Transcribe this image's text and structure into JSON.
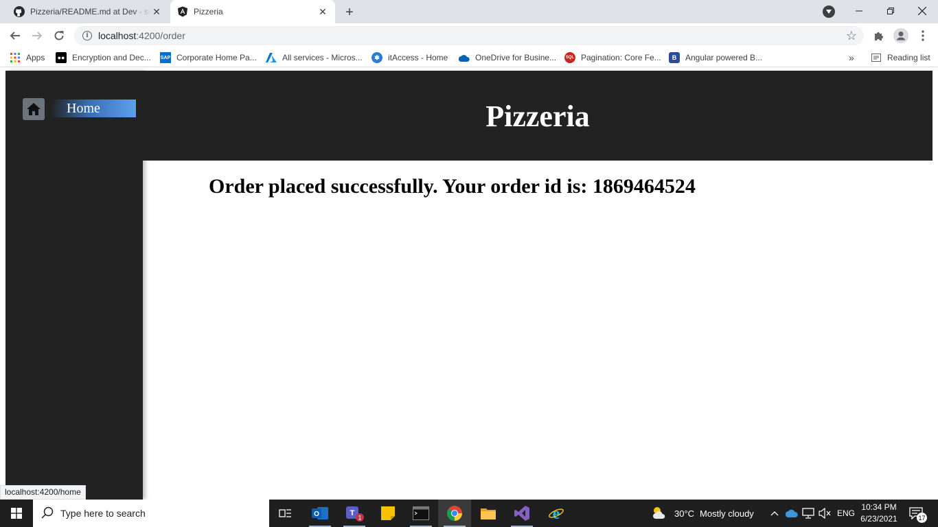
{
  "browser": {
    "tabs": [
      {
        "title": "Pizzeria/README.md at Dev · sud",
        "favicon": "github-icon",
        "active": false
      },
      {
        "title": "Pizzeria",
        "favicon": "angular-icon",
        "active": true
      }
    ],
    "address": {
      "host": "localhost",
      "path": ":4200/order"
    },
    "bookmarks": [
      {
        "label": "Apps",
        "icon": "apps-grid-icon"
      },
      {
        "label": "Encryption and Dec...",
        "icon": "medium-icon"
      },
      {
        "label": "Corporate Home Pa...",
        "icon": "sap-icon"
      },
      {
        "label": "All services - Micros...",
        "icon": "azure-icon"
      },
      {
        "label": "itAccess - Home",
        "icon": "itaccess-icon"
      },
      {
        "label": "OneDrive for Busine...",
        "icon": "onedrive-icon"
      },
      {
        "label": "Pagination: Core Fe...",
        "icon": "sql-icon"
      },
      {
        "label": "Angular powered B...",
        "icon": "bootstrap-icon"
      }
    ],
    "reading_list": "Reading list",
    "status_bar": "localhost:4200/home"
  },
  "app": {
    "title": "Pizzeria",
    "nav": {
      "home_label": "Home"
    },
    "order_message": "Order placed successfully. Your order id is: 1869464524"
  },
  "taskbar": {
    "search_placeholder": "Type here to search",
    "weather": {
      "temp": "30°C",
      "condition": "Mostly cloudy"
    },
    "language": "ENG",
    "time": "10:34 PM",
    "date": "6/23/2021",
    "notification_count": "17",
    "teams_badge": "1"
  },
  "colors": {
    "header_bg": "#222222",
    "nav_gradient_end": "#5da0f0",
    "taskbar_bg": "#1f1f1f"
  }
}
